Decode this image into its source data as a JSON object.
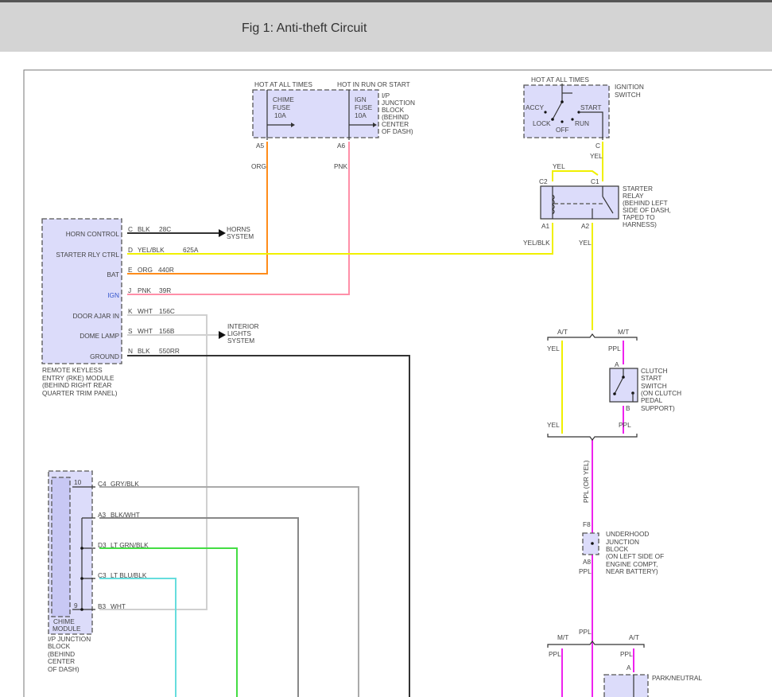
{
  "header": {
    "title": "Fig 1: Anti-theft Circuit"
  },
  "ip_block_top": {
    "hot_all": "HOT AT ALL TIMES",
    "hot_run": "HOT IN RUN OR START",
    "chime_fuse": [
      "CHIME",
      "FUSE",
      "10A"
    ],
    "ign_fuse": [
      "IGN",
      "FUSE",
      "10A"
    ],
    "label": [
      "I/P",
      "JUNCTION",
      "BLOCK",
      "(BEHIND",
      "CENTER",
      "OF DASH)"
    ],
    "pin_a5": "A5",
    "pin_a6": "A6",
    "wire_org": "ORG",
    "wire_pnk": "PNK"
  },
  "ignition_switch": {
    "hot": "HOT AT ALL TIMES",
    "label": [
      "IGNITION",
      "SWITCH"
    ],
    "accy": "ACCY",
    "lock": "LOCK",
    "off": "OFF",
    "start": "START",
    "run": "RUN",
    "pin": "C",
    "wire": "YEL"
  },
  "starter_relay": {
    "wire_c2": "YEL",
    "pin_c2": "C2",
    "pin_c1": "C1",
    "pin_a1": "A1",
    "pin_a2": "A2",
    "label": [
      "STARTER",
      "RELAY",
      "(BEHIND LEFT",
      "SIDE OF DASH,",
      "TAPED TO",
      "HARNESS)"
    ],
    "wire_a1": "YEL/BLK",
    "wire_a2": "YEL"
  },
  "rke_module": {
    "pins": [
      {
        "name": "HORN CONTROL",
        "pin": "C",
        "color": "BLK",
        "circuit": "28C"
      },
      {
        "name": "STARTER RLY CTRL",
        "pin": "D",
        "color": "YEL/BLK",
        "circuit": "625A"
      },
      {
        "name": "BAT",
        "pin": "E",
        "color": "ORG",
        "circuit": "440R"
      },
      {
        "name": "IGN",
        "pin": "J",
        "color": "PNK",
        "circuit": "39R"
      },
      {
        "name": "DOOR AJAR IN",
        "pin": "K",
        "color": "WHT",
        "circuit": "156C"
      },
      {
        "name": "DOME LAMP",
        "pin": "S",
        "color": "WHT",
        "circuit": "156B"
      },
      {
        "name": "GROUND",
        "pin": "N",
        "color": "BLK",
        "circuit": "550RR"
      }
    ],
    "horns": [
      "HORNS",
      "SYSTEM"
    ],
    "interior": [
      "INTERIOR",
      "LIGHTS",
      "SYSTEM"
    ],
    "label": [
      "REMOTE KEYLESS",
      "ENTRY (RKE) MODULE",
      "(BEHIND RIGHT REAR",
      "QUARTER TRIM PANEL)"
    ]
  },
  "chime_module": {
    "pins": [
      {
        "pin": "C4",
        "color": "GRY/BLK"
      },
      {
        "pin": "A3",
        "color": "BLK/WHT"
      },
      {
        "pin": "D3",
        "color": "LT GRN/BLK"
      },
      {
        "pin": "C3",
        "color": "LT BLU/BLK"
      },
      {
        "pin": "B3",
        "color": "WHT"
      }
    ],
    "inner_10": "10",
    "inner_9": "9",
    "label": [
      "CHIME",
      "MODULE"
    ],
    "block_label": [
      "I/P JUNCTION",
      "BLOCK",
      "(BEHIND",
      "CENTER",
      "OF DASH)"
    ]
  },
  "transmission_split_1": {
    "at": "A/T",
    "mt": "M/T",
    "at_wire": "YEL",
    "mt_wire": "PPL",
    "at_wire2": "YEL",
    "mt_wire2": "PPL"
  },
  "clutch_switch": {
    "pin_a": "A",
    "pin_b": "B",
    "label": [
      "CLUTCH",
      "START",
      "SWITCH",
      "(ON CLUTCH",
      "PEDAL",
      "SUPPORT)"
    ]
  },
  "vertical_wire": "PPL (OR YEL)",
  "underhood_block": {
    "pin_f8": "F8",
    "pin_a8": "A8",
    "wire": "PPL",
    "label": [
      "UNDERHOOD",
      "JUNCTION",
      "BLOCK",
      "(ON LEFT SIDE OF",
      "ENGINE COMPT,",
      "NEAR BATTERY)"
    ]
  },
  "transmission_split_2": {
    "wire_in": "PPL",
    "mt": "M/T",
    "at": "A/T",
    "mt_wire": "PPL",
    "at_wire": "PPL",
    "pin_a": "A"
  },
  "park_neutral": {
    "label": "PARK/NEUTRAL"
  },
  "wire_colors": {
    "org": "#ff8c1a",
    "pnk": "#ff8fa8",
    "yel": "#f0f000",
    "ppl": "#ee22ee",
    "wht": "#d0d0d0",
    "blk": "#333333",
    "gry": "#aaaaaa",
    "blkwht": "#888888",
    "ltgrn": "#44dd44",
    "ltblu": "#66dddd"
  }
}
